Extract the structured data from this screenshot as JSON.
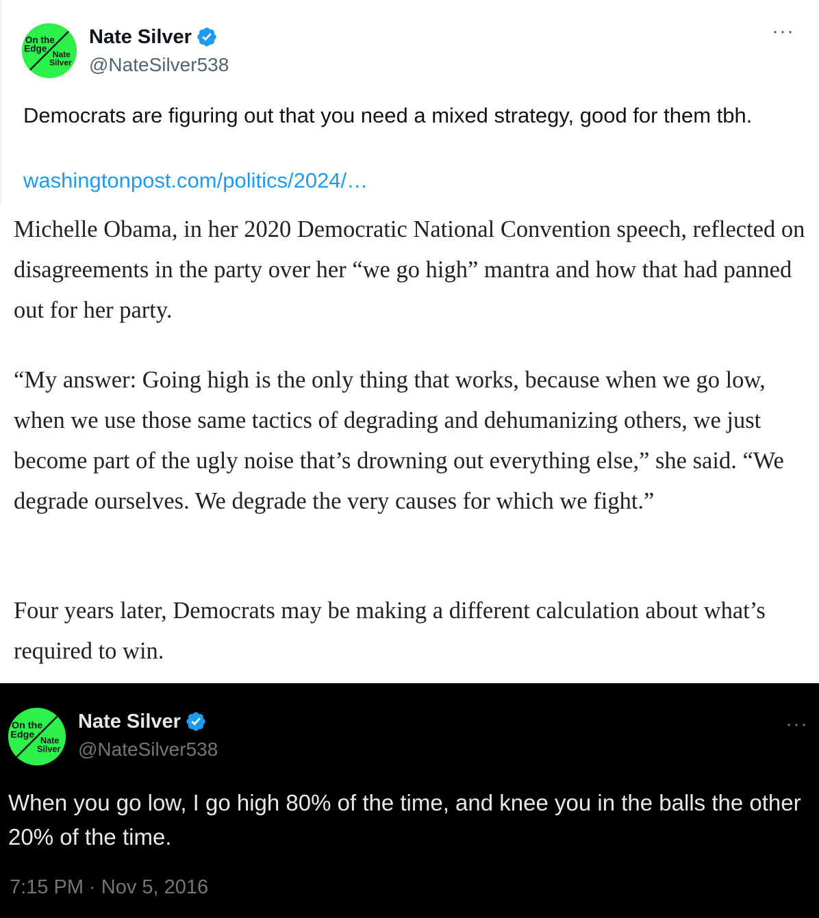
{
  "top_tweet": {
    "author": {
      "name": "Nate Silver",
      "handle": "@NateSilver538",
      "avatar_text": {
        "line1": "On the",
        "line2": "Edge",
        "line3": "Nate",
        "line4": "Silver"
      }
    },
    "more_label": "···",
    "text": "Democrats are figuring out that you need a mixed strategy, good for them tbh.",
    "link": "washingtonpost.com/politics/2024/…"
  },
  "article": {
    "paragraphs": [
      "Michelle Obama, in her 2020 Democratic National Convention speech, reflected on disagreements in the party over her “we go high” mantra and how that had panned out for her party.",
      "“My answer: Going high is the only thing that works, because when we go low, when we use those same tactics of degrading and dehumanizing others, we just become part of the ugly noise that’s drowning out everything else,” she said. “We degrade ourselves. We degrade the very causes for which we fight.”",
      "Four years later, Democrats may be making a different calculation about what’s required to win."
    ]
  },
  "quoted_tweet": {
    "author": {
      "name": "Nate Silver",
      "handle": "@NateSilver538",
      "avatar_text": {
        "line1": "On the",
        "line2": "Edge",
        "line3": "Nate",
        "line4": "Silver"
      }
    },
    "more_label": "···",
    "text": "When you go low, I go high 80% of the time, and knee you in the balls the other 20% of the time.",
    "timestamp": "7:15 PM · Nov 5, 2016"
  },
  "colors": {
    "avatar_green": "#2ef04a",
    "verified_blue": "#1d9bf0",
    "link_blue": "#1d9bf0",
    "dark_background": "#000000"
  },
  "icons": {
    "verified": "verified-badge-icon",
    "more": "more-options-icon"
  }
}
